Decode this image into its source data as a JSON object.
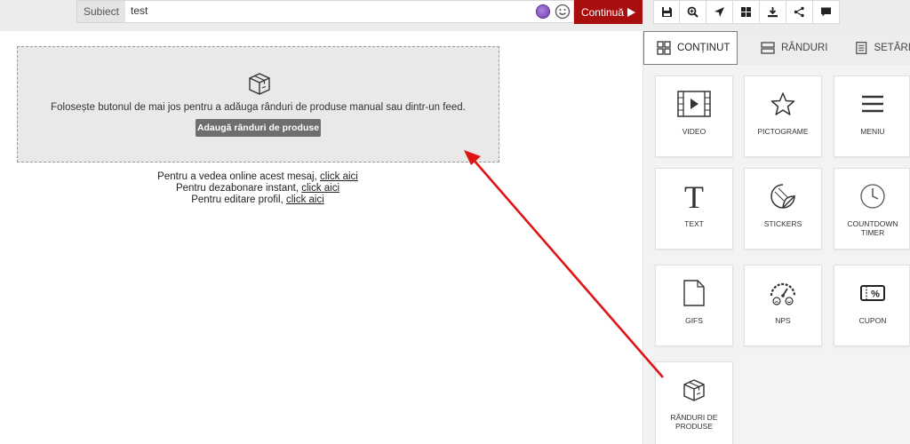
{
  "topbar": {
    "subject_label": "Subiect",
    "subject_value": "test",
    "continue_label": "Continuă",
    "tools": [
      "save-icon",
      "zoom-icon",
      "send-icon",
      "grid-icon",
      "download-icon",
      "share-icon",
      "comment-icon"
    ]
  },
  "canvas": {
    "block_text": "Folosește butonul de mai jos pentru a adăuga rânduri de produse manual sau dintr-un feed.",
    "block_button": "Adaugă rânduri de produse",
    "footer": [
      {
        "prefix": "Pentru a vedea online acest mesaj, ",
        "link": "click aici"
      },
      {
        "prefix": "Pentru dezabonare instant, ",
        "link": "click aici"
      },
      {
        "prefix": "Pentru editare profil, ",
        "link": "click aici"
      }
    ]
  },
  "sidebar": {
    "tabs": [
      {
        "label": "CONȚINUT",
        "icon": "grid-icon"
      },
      {
        "label": "RÂNDURI",
        "icon": "rows-icon"
      },
      {
        "label": "SETĂRI",
        "icon": "settings-icon"
      }
    ],
    "tiles": [
      {
        "label": "VIDEO",
        "icon": "film-icon"
      },
      {
        "label": "PICTOGRAME",
        "icon": "star-icon"
      },
      {
        "label": "MENIU",
        "icon": "menu-icon"
      },
      {
        "label": "TEXT",
        "icon": "text-icon"
      },
      {
        "label": "STICKERS",
        "icon": "sticker-icon"
      },
      {
        "label": "COUNTDOWN TIMER",
        "icon": "clock-icon"
      },
      {
        "label": "GIFS",
        "icon": "file-icon"
      },
      {
        "label": "NPS",
        "icon": "gauge-icon"
      },
      {
        "label": "CUPON",
        "icon": "coupon-icon"
      },
      {
        "label": "RÂNDURI DE PRODUSE",
        "icon": "box-icon"
      }
    ]
  },
  "colors": {
    "accent": "#a80e0e",
    "arrow": "#e01414",
    "block_bg": "#e9e9e9",
    "button_bg": "#6e6e6e"
  }
}
